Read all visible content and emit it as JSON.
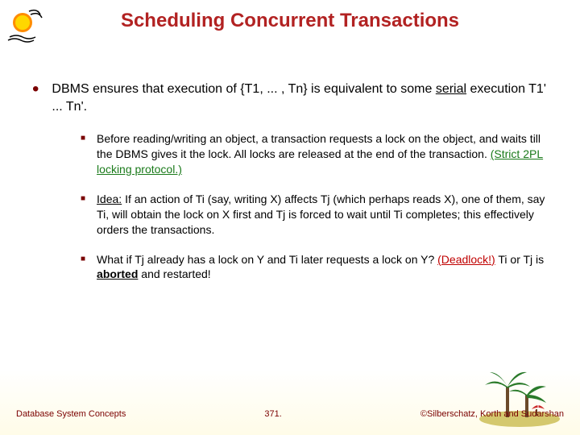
{
  "title": "Scheduling Concurrent Transactions",
  "mainBullet": {
    "pre": "DBMS ensures that execution of {T1, ... , Tn} is equivalent to some ",
    "serial": "serial",
    "post": " execution T1' ... Tn'."
  },
  "sub": [
    {
      "pre": "Before reading/writing an object, a transaction requests a lock on the object, and waits till the DBMS gives it the lock.  All locks are released at the end of the transaction.  ",
      "link": "(Strict 2PL locking protocol.)"
    },
    {
      "ideaLabel": "Idea:",
      "text": " If an action of Ti (say, writing X) affects Tj (which perhaps reads X), one of them, say Ti, will obtain the lock on X first and Tj is forced to wait until Ti completes; this effectively orders the transactions."
    },
    {
      "pre": "What if Tj already has a lock on Y and Ti later requests a lock on Y?  ",
      "deadlock": "(Deadlock!)",
      "mid": " Ti or Tj is ",
      "aborted": "aborted",
      "post": " and restarted!"
    }
  ],
  "footer": {
    "left": "Database System Concepts",
    "center": "371.",
    "right": "©Silberschatz, Korth and Sudarshan"
  }
}
